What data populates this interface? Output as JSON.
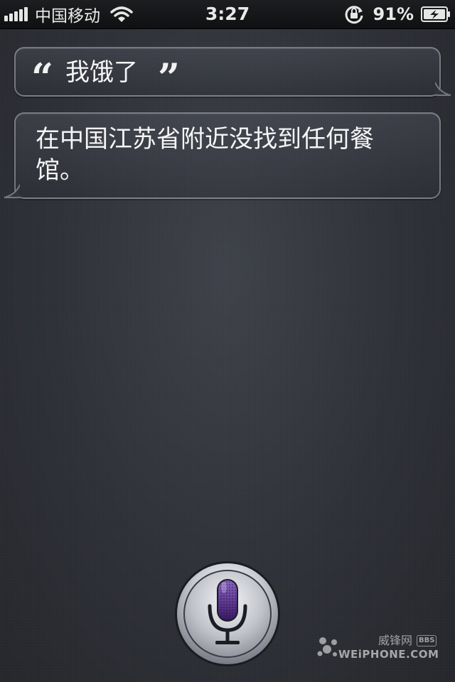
{
  "status_bar": {
    "carrier": "中国移动",
    "time": "3:27",
    "battery_percent": "91%",
    "signal_bars": 5,
    "icons": [
      "signal-icon",
      "wifi-icon",
      "rotation-lock-icon",
      "battery-charging-icon"
    ]
  },
  "conversation": {
    "user_quote_open": "“",
    "user_message": "我饿了",
    "user_quote_close": "”",
    "siri_response": "在中国江苏省附近没找到任何餐馆。"
  },
  "mic": {
    "icon": "microphone-icon",
    "accent_color": "#5b2d8c"
  },
  "watermark": {
    "cn": "威锋网",
    "en": "WEiPHONE.COM",
    "badge": "BBS"
  }
}
